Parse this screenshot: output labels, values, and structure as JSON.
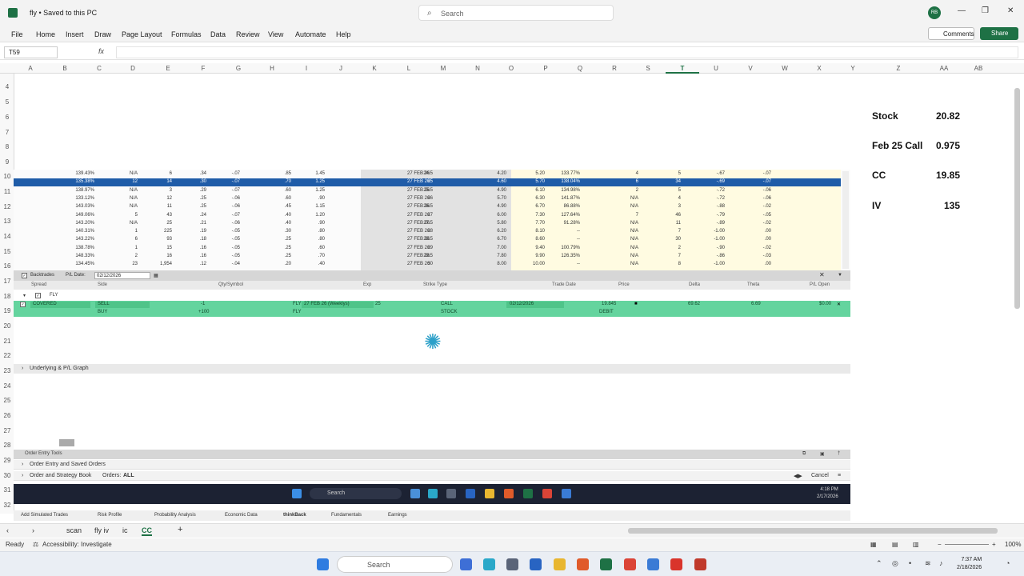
{
  "titlebar": {
    "title": "fly • Saved to this PC",
    "search_placeholder": "Search",
    "avatar": "RB"
  },
  "ribbon": {
    "tabs": [
      "File",
      "Home",
      "Insert",
      "Draw",
      "Page Layout",
      "Formulas",
      "Data",
      "Review",
      "View",
      "Automate",
      "Help"
    ],
    "comments": "Comments",
    "share": "Share"
  },
  "formulabar": {
    "namebox": "T59",
    "fx": "fx"
  },
  "columns": [
    "A",
    "B",
    "C",
    "D",
    "E",
    "F",
    "G",
    "H",
    "I",
    "J",
    "K",
    "L",
    "M",
    "N",
    "O",
    "P",
    "Q",
    "R",
    "S",
    "T",
    "U",
    "V",
    "W",
    "X",
    "Y",
    "Z",
    "AA",
    "AB"
  ],
  "rows": [
    "4",
    "5",
    "6",
    "7",
    "8",
    "9",
    "10",
    "11",
    "12",
    "13",
    "14",
    "15",
    "16",
    "17",
    "18",
    "19",
    "20",
    "21",
    "22",
    "23",
    "24",
    "25",
    "26",
    "27",
    "28",
    "29",
    "30",
    "31",
    "32"
  ],
  "summary": [
    {
      "label": "Stock",
      "value": "20.82"
    },
    {
      "label": "Feb 25 Call",
      "value": "0.975"
    },
    {
      "label": "CC",
      "value": "19.85"
    },
    {
      "label": "IV",
      "value": "135"
    }
  ],
  "chain": {
    "rows": [
      [
        "139.43%",
        "N/A",
        "6",
        ".34",
        "-.07",
        ".85",
        "1.45",
        "27 FEB 26",
        "24.5",
        "4.20",
        "5.20",
        "133.77%",
        "4",
        "5",
        "-.67",
        "-.07"
      ],
      [
        "135.38%",
        "12",
        "14",
        ".30",
        "-.07",
        ".70",
        "1.25",
        "27 FEB 26",
        "25",
        "4.60",
        "5.70",
        "138.04%",
        "6",
        "34",
        "-.69",
        "-.07"
      ],
      [
        "138.97%",
        "N/A",
        "3",
        ".29",
        "-.07",
        ".60",
        "1.25",
        "27 FEB 26",
        "25.5",
        "4.90",
        "6.10",
        "134.98%",
        "2",
        "5",
        "-.72",
        "-.06"
      ],
      [
        "133.12%",
        "N/A",
        "12",
        ".25",
        "-.06",
        ".60",
        ".90",
        "27 FEB 26",
        "26",
        "5.70",
        "6.30",
        "141.87%",
        "N/A",
        "4",
        "-.72",
        "-.06"
      ],
      [
        "143.03%",
        "N/A",
        "11",
        ".25",
        "-.06",
        ".45",
        "1.15",
        "27 FEB 26",
        "26.5",
        "4.90",
        "6.70",
        "86.88%",
        "N/A",
        "3",
        "-.88",
        "-.02"
      ],
      [
        "149.06%",
        "5",
        "43",
        ".24",
        "-.07",
        ".40",
        "1.20",
        "27 FEB 26",
        "27",
        "6.00",
        "7.30",
        "127.64%",
        "7",
        "46",
        "-.79",
        "-.05"
      ],
      [
        "143.20%",
        "N/A",
        "25",
        ".21",
        "-.06",
        ".40",
        ".90",
        "27 FEB 26",
        "27.5",
        "5.80",
        "7.70",
        "91.28%",
        "N/A",
        "11",
        "-.89",
        "-.02"
      ],
      [
        "140.31%",
        "1",
        "225",
        ".19",
        "-.05",
        ".30",
        ".80",
        "27 FEB 26",
        "28",
        "6.20",
        "8.10",
        "--",
        "N/A",
        "7",
        "-1.00",
        ".00"
      ],
      [
        "143.22%",
        "6",
        "93",
        ".18",
        "-.05",
        ".25",
        ".80",
        "27 FEB 26",
        "28.5",
        "6.70",
        "8.60",
        "--",
        "N/A",
        "30",
        "-1.00",
        ".00"
      ],
      [
        "138.78%",
        "1",
        "15",
        ".16",
        "-.05",
        ".25",
        ".60",
        "27 FEB 26",
        "29",
        "7.00",
        "9.40",
        "100.79%",
        "N/A",
        "2",
        "-.90",
        "-.02"
      ],
      [
        "148.33%",
        "2",
        "16",
        ".16",
        "-.05",
        ".25",
        ".70",
        "27 FEB 26",
        "29.5",
        "7.80",
        "9.90",
        "126.35%",
        "N/A",
        "7",
        "-.86",
        "-.03"
      ],
      [
        "134.45%",
        "23",
        "1,954",
        ".12",
        "-.04",
        ".20",
        ".40",
        "27 FEB 26",
        "30",
        "8.00",
        "10.00",
        "--",
        "N/A",
        "8",
        "-1.00",
        ".00"
      ]
    ]
  },
  "backtrades": {
    "title": "Backtrades",
    "pl_date_label": "P/L Date:",
    "pl_date": "02/12/2026",
    "columns": [
      "Spread",
      "Side",
      "Qty/Symbol",
      "Exp",
      "Strike Type",
      "Trade Date",
      "Price",
      "Delta",
      "Theta",
      "P/L Open"
    ],
    "group": "FLY",
    "trade1": {
      "spread": "COVERED",
      "side": "SELL",
      "qty": "-1",
      "symbol": "FLY",
      "exp": "27 FEB 26 (Weeklys)",
      "strike": "25",
      "type": "CALL",
      "date": "02/12/2026",
      "price": "19.845",
      "delta": "69.62",
      "theta": "6.69",
      "pl": "$0.00"
    },
    "trade2": {
      "side": "BUY",
      "qty": "+100",
      "symbol": "FLY",
      "type": "STOCK",
      "price": "DEBIT"
    }
  },
  "sections": {
    "graph": "Underlying & P/L Graph",
    "order_entry_tools": "Order Entry Tools",
    "order_entry": "Order Entry and Saved Orders",
    "book": "Order and Strategy Book",
    "orders_label": "Orders:",
    "orders_value": "ALL",
    "cancel": "Cancel"
  },
  "inner_taskbar": {
    "search": "Search",
    "time": "4:18 PM",
    "date": "2/17/2026"
  },
  "tos_tabs": [
    "Add Simulated Trades",
    "Risk Profile",
    "Probability Analysis",
    "Economic Data",
    "thinkBack",
    "Fundamentals",
    "Earnings"
  ],
  "tos_tab_active": "thinkBack",
  "sheets": [
    "scan",
    "fly iv",
    "ic",
    "CC"
  ],
  "sheet_active": "CC",
  "status": {
    "ready": "Ready",
    "accessibility": "Accessibility: Investigate",
    "zoom": "100%"
  },
  "taskbar": {
    "search": "Search",
    "time": "7:37 AM",
    "date": "2/18/2026"
  },
  "colors": {
    "excel_green": "#1e7145",
    "trade_row": "#64d49e",
    "selected_row": "#1f5ca8",
    "chain_yellow": "#fffbe1"
  }
}
